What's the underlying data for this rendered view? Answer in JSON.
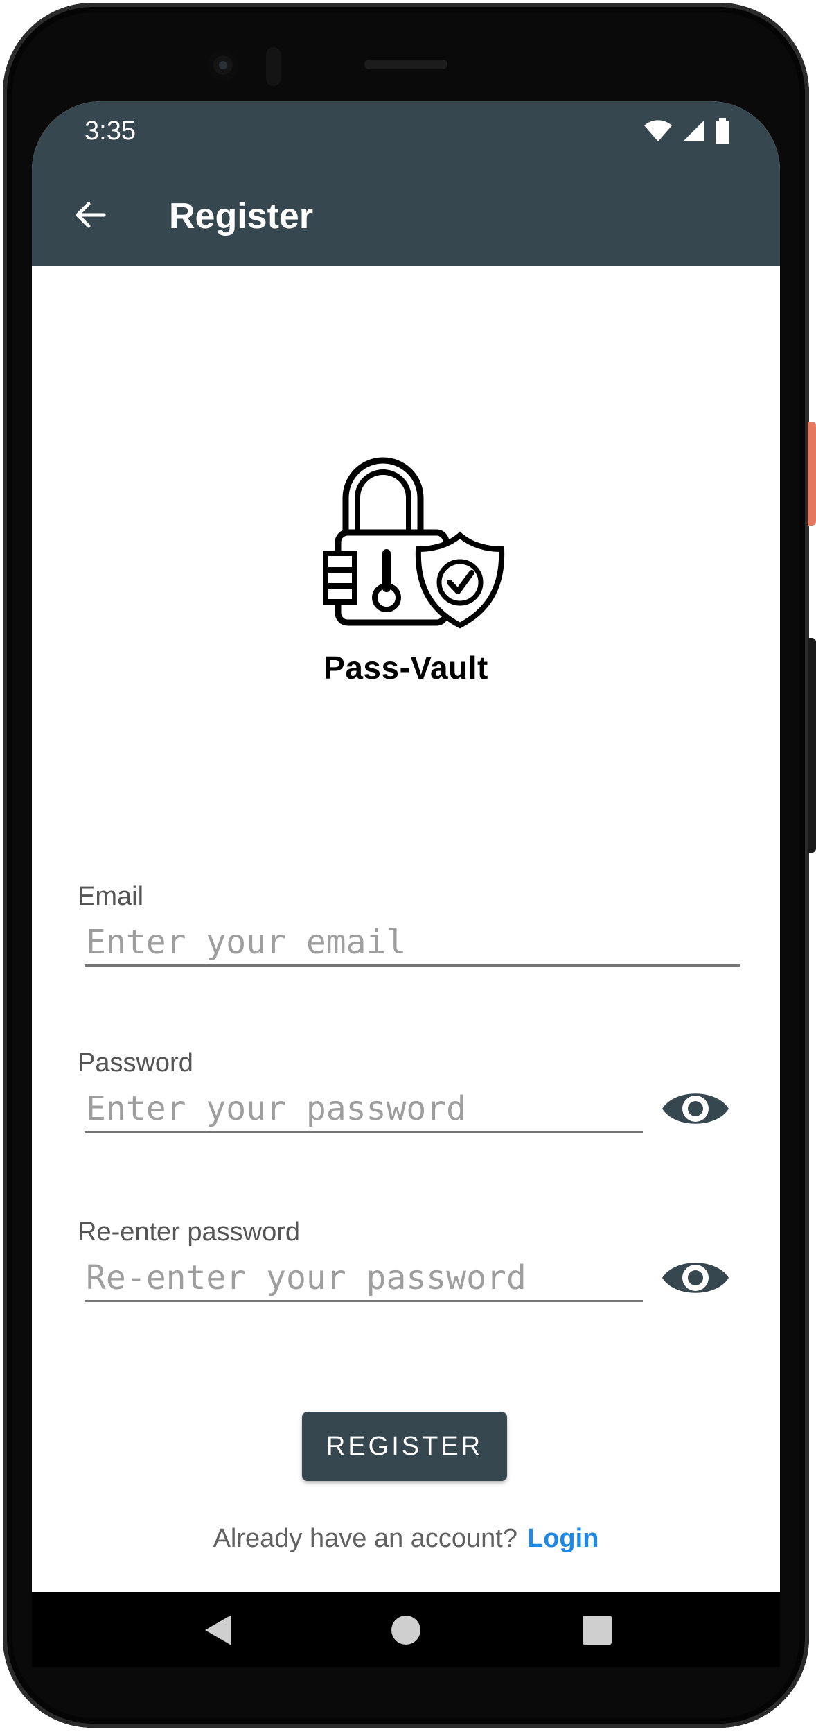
{
  "status_bar": {
    "time": "3:35"
  },
  "app_bar": {
    "title": "Register"
  },
  "logo": {
    "brand": "Pass-Vault"
  },
  "form": {
    "email": {
      "label": "Email",
      "placeholder": "Enter your email"
    },
    "password": {
      "label": "Password",
      "placeholder": "Enter your password"
    },
    "reenter": {
      "label": "Re-enter password",
      "placeholder": "Re-enter your password"
    },
    "register_label": "REGISTER"
  },
  "footer": {
    "prompt": "Already have an account?",
    "login_label": "Login"
  },
  "colors": {
    "primary": "#37474f",
    "link": "#1e88e5",
    "side_button": "#e5775c"
  },
  "icons": [
    "back-arrow-icon",
    "wifi-icon",
    "signal-icon",
    "battery-icon",
    "padlock-shield-logo",
    "eye-icon",
    "nav-back-icon",
    "nav-home-icon",
    "nav-recents-icon"
  ]
}
